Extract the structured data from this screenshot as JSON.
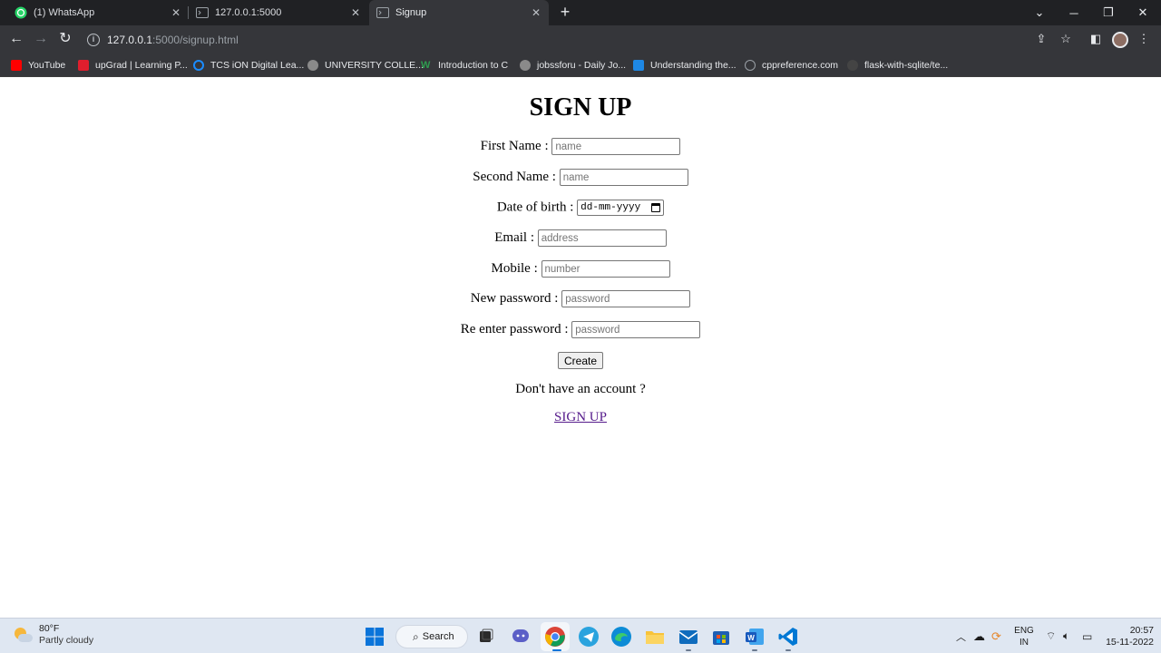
{
  "browser": {
    "tabs": [
      {
        "title": "(1) WhatsApp",
        "icon": "whatsapp-icon",
        "active": false
      },
      {
        "title": "127.0.0.1:5000",
        "icon": "terminal-icon",
        "active": false
      },
      {
        "title": "Signup",
        "icon": "terminal-icon",
        "active": true
      }
    ],
    "url_host": "127.0.0.1",
    "url_rest": ":5000/signup.html",
    "bookmarks": [
      {
        "label": "YouTube",
        "icon": "youtube-icon",
        "color": "#ff0000"
      },
      {
        "label": "upGrad | Learning P...",
        "icon": "upgrad-icon",
        "color": "#e01e2d"
      },
      {
        "label": "TCS iON Digital Lea...",
        "icon": "tcs-power-icon",
        "color": "#1a8cff"
      },
      {
        "label": "UNIVERSITY COLLE...",
        "icon": "globe-icon",
        "color": "#8a8a8a"
      },
      {
        "label": "Introduction to C",
        "icon": "w-icon",
        "color": "#2e9c4f"
      },
      {
        "label": "jobssforu - Daily Jo...",
        "icon": "globe-icon",
        "color": "#8a8a8a"
      },
      {
        "label": "Understanding the...",
        "icon": "play-icon",
        "color": "#1e88e5"
      },
      {
        "label": "cppreference.com",
        "icon": "cppreference-icon",
        "color": "#777777"
      },
      {
        "label": "flask-with-sqlite/te...",
        "icon": "github-icon",
        "color": "#444444"
      }
    ]
  },
  "form": {
    "title": "SIGN UP",
    "first_name_label": "First Name :",
    "first_name_placeholder": "name",
    "second_name_label": "Second Name :",
    "second_name_placeholder": "name",
    "dob_label": "Date of birth :",
    "dob_value": "dd-mm-yyyy",
    "email_label": "Email :",
    "email_placeholder": "address",
    "mobile_label": "Mobile :",
    "mobile_placeholder": "number",
    "new_password_label": "New password :",
    "new_password_placeholder": "password",
    "reenter_password_label": "Re enter password :",
    "reenter_password_placeholder": "password",
    "create_button": "Create",
    "account_prompt": "Don't have an account ?",
    "signup_link": "SIGN UP"
  },
  "taskbar": {
    "weather_temp": "80°F",
    "weather_desc": "Partly cloudy",
    "search_label": "Search",
    "lang_top": "ENG",
    "lang_bottom": "IN",
    "time": "20:57",
    "date": "15-11-2022"
  }
}
